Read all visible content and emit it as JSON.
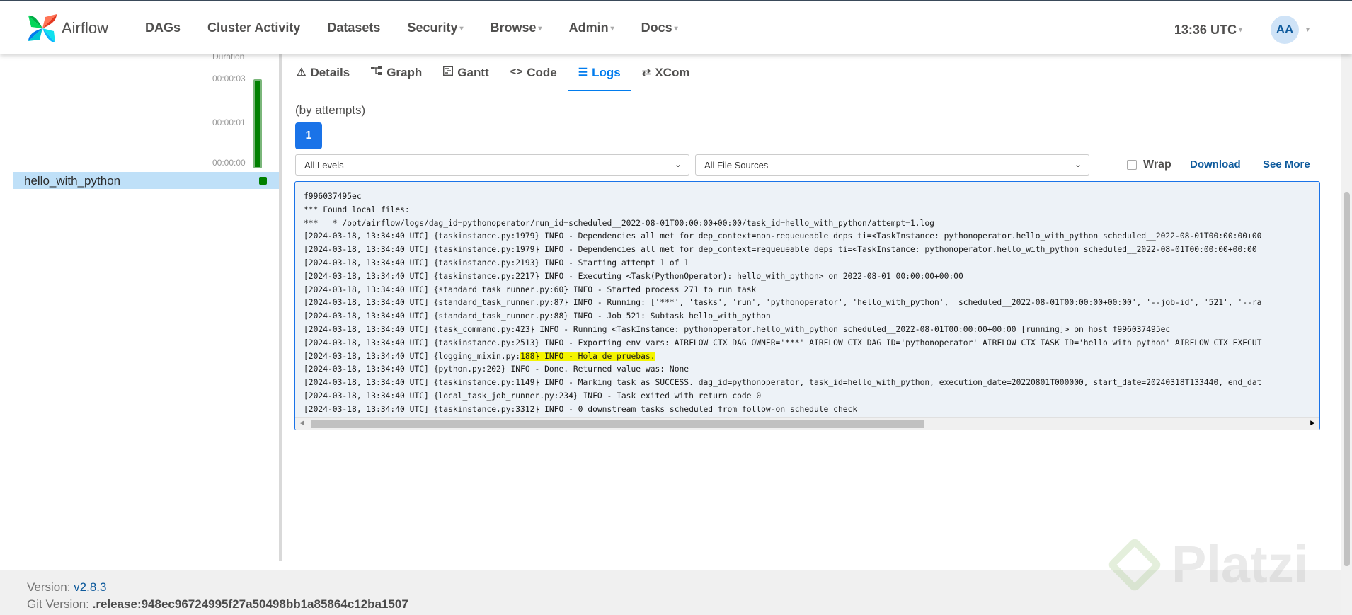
{
  "brand": {
    "name": "Airflow"
  },
  "nav": {
    "items": [
      {
        "label": "DAGs",
        "dropdown": false
      },
      {
        "label": "Cluster Activity",
        "dropdown": false
      },
      {
        "label": "Datasets",
        "dropdown": false
      },
      {
        "label": "Security",
        "dropdown": true
      },
      {
        "label": "Browse",
        "dropdown": true
      },
      {
        "label": "Admin",
        "dropdown": true
      },
      {
        "label": "Docs",
        "dropdown": true
      }
    ],
    "time": "13:36 UTC",
    "avatar": "AA"
  },
  "grid": {
    "duration_label": "Duration",
    "ticks": [
      "00:00:03",
      "00:00:01",
      "00:00:00"
    ],
    "task_name": "hello_with_python",
    "task_state_color": "#008000"
  },
  "tabs": [
    {
      "label": "Details",
      "icon": "warning-triangle-icon",
      "active": false
    },
    {
      "label": "Graph",
      "icon": "graph-icon",
      "active": false
    },
    {
      "label": "Gantt",
      "icon": "gantt-icon",
      "active": false
    },
    {
      "label": "Code",
      "icon": "code-icon",
      "active": false
    },
    {
      "label": "Logs",
      "icon": "list-icon",
      "active": true
    },
    {
      "label": "XCom",
      "icon": "swap-arrows-icon",
      "active": false
    }
  ],
  "logs": {
    "by_attempts": "(by attempts)",
    "attempt": "1",
    "level_select": "All Levels",
    "source_select": "All File Sources",
    "wrap_label": "Wrap",
    "wrap_checked": false,
    "download_label": "Download",
    "see_more_label": "See More",
    "lines": [
      "f996037495ec",
      "*** Found local files:",
      "***   * /opt/airflow/logs/dag_id=pythonoperator/run_id=scheduled__2022-08-01T00:00:00+00:00/task_id=hello_with_python/attempt=1.log",
      "[2024-03-18, 13:34:40 UTC] {taskinstance.py:1979} INFO - Dependencies all met for dep_context=non-requeueable deps ti=<TaskInstance: pythonoperator.hello_with_python scheduled__2022-08-01T00:00:00+00",
      "[2024-03-18, 13:34:40 UTC] {taskinstance.py:1979} INFO - Dependencies all met for dep_context=requeueable deps ti=<TaskInstance: pythonoperator.hello_with_python scheduled__2022-08-01T00:00:00+00:00",
      "[2024-03-18, 13:34:40 UTC] {taskinstance.py:2193} INFO - Starting attempt 1 of 1",
      "[2024-03-18, 13:34:40 UTC] {taskinstance.py:2217} INFO - Executing <Task(PythonOperator): hello_with_python> on 2022-08-01 00:00:00+00:00",
      "[2024-03-18, 13:34:40 UTC] {standard_task_runner.py:60} INFO - Started process 271 to run task",
      "[2024-03-18, 13:34:40 UTC] {standard_task_runner.py:87} INFO - Running: ['***', 'tasks', 'run', 'pythonoperator', 'hello_with_python', 'scheduled__2022-08-01T00:00:00+00:00', '--job-id', '521', '--ra",
      "[2024-03-18, 13:34:40 UTC] {standard_task_runner.py:88} INFO - Job 521: Subtask hello_with_python",
      "[2024-03-18, 13:34:40 UTC] {task_command.py:423} INFO - Running <TaskInstance: pythonoperator.hello_with_python scheduled__2022-08-01T00:00:00+00:00 [running]> on host f996037495ec",
      "[2024-03-18, 13:34:40 UTC] {taskinstance.py:2513} INFO - Exporting env vars: AIRFLOW_CTX_DAG_OWNER='***' AIRFLOW_CTX_DAG_ID='pythonoperator' AIRFLOW_CTX_TASK_ID='hello_with_python' AIRFLOW_CTX_EXECUT",
      "[2024-03-18, 13:34:40 UTC] {logging_mixin.py:188} INFO - Hola de pruebas.",
      "[2024-03-18, 13:34:40 UTC] {python.py:202} INFO - Done. Returned value was: None",
      "[2024-03-18, 13:34:40 UTC] {taskinstance.py:1149} INFO - Marking task as SUCCESS. dag_id=pythonoperator, task_id=hello_with_python, execution_date=20220801T000000, start_date=20240318T133440, end_dat",
      "[2024-03-18, 13:34:40 UTC] {local_task_job_runner.py:234} INFO - Task exited with return code 0",
      "[2024-03-18, 13:34:40 UTC] {taskinstance.py:3312} INFO - 0 downstream tasks scheduled from follow-on schedule check"
    ],
    "highlight": {
      "line": 12,
      "text": "188} INFO - Hola de pruebas."
    }
  },
  "footer": {
    "version_label": "Version:",
    "version": "v2.8.3",
    "git_label": "Git Version:",
    "git_version": ".release:948ec96724995f27a50498bb1a85864c12ba1507"
  },
  "watermark": {
    "text": "Platzi"
  }
}
